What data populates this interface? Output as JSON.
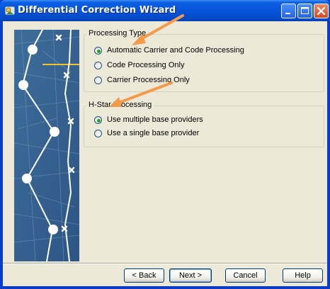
{
  "window": {
    "title": "Differential Correction Wizard"
  },
  "groups": [
    {
      "legend": "Processing Type",
      "options": [
        {
          "label": "Automatic Carrier and Code Processing",
          "selected": true
        },
        {
          "label": "Code Processing Only",
          "selected": false
        },
        {
          "label": "Carrier Processing Only",
          "selected": false
        }
      ]
    },
    {
      "legend": "H-Star Processing",
      "options": [
        {
          "label": "Use multiple base providers",
          "selected": true
        },
        {
          "label": "Use a single base provider",
          "selected": false
        }
      ]
    }
  ],
  "buttons": {
    "back": "< Back",
    "next": "Next >",
    "cancel": "Cancel",
    "help": "Help"
  },
  "colors": {
    "titlebar": "#0655db",
    "dialog_bg": "#ece9d8",
    "annotation_arrow": "#f39a4b",
    "radio_dot": "#21a121"
  }
}
